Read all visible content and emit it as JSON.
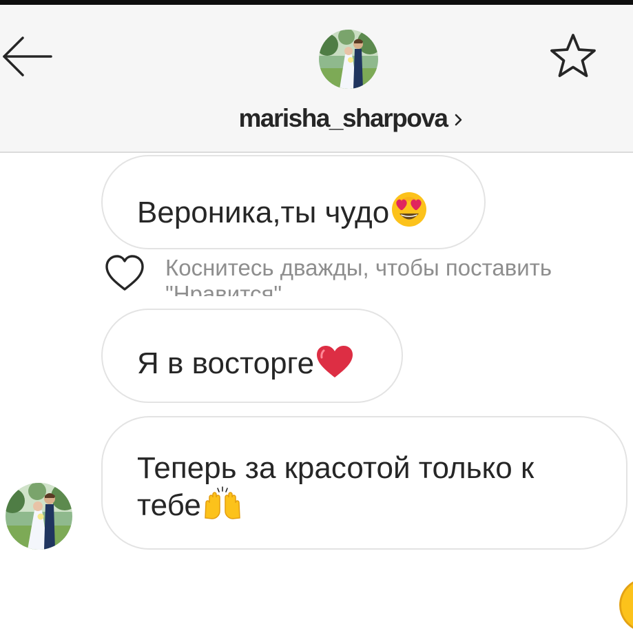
{
  "header": {
    "username": "marisha_sharpova",
    "back_icon": "arrow-left-icon",
    "star_icon": "star-outline-icon",
    "chevron_icon": "chevron-right-icon",
    "background": "#f6f6f6"
  },
  "messages": [
    {
      "text": "Вероника,ты чудо",
      "emoji": "heart-eyes-emoji"
    },
    {
      "text": "Я в восторге",
      "emoji": "red-heart-emoji"
    },
    {
      "lines": [
        "Теперь  за красотой только к",
        "тебе"
      ],
      "emoji": "raising-hands-emoji"
    }
  ],
  "like_hint": "Коснитесь дважды, чтобы поставить \"Нравится\"",
  "colors": {
    "text": "#262626",
    "hint": "#8e8e8e",
    "bubble_border": "#e3e3e3",
    "emoji_yellow": "#fcc21b",
    "heart_red": "#dd2e44"
  }
}
